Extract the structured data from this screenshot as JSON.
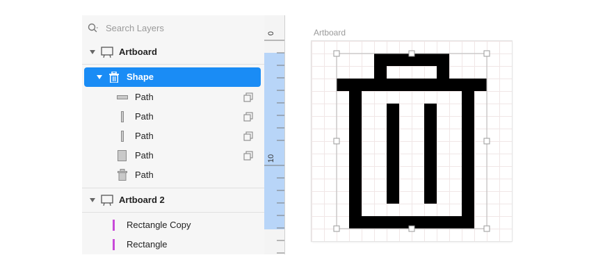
{
  "search": {
    "placeholder": "Search Layers"
  },
  "layers": {
    "artboard1": {
      "name": "Artboard",
      "children": [
        {
          "name": "Shape",
          "children": [
            {
              "name": "Path",
              "icon": "horizontal-bar-icon"
            },
            {
              "name": "Path",
              "icon": "vertical-bar-icon"
            },
            {
              "name": "Path",
              "icon": "vertical-bar-icon"
            },
            {
              "name": "Path",
              "icon": "rectangle-icon"
            },
            {
              "name": "Path",
              "icon": "trash-path-icon"
            }
          ]
        }
      ]
    },
    "artboard2": {
      "name": "Artboard 2",
      "children": [
        {
          "name": "Rectangle Copy",
          "icon": "magenta-line-icon"
        },
        {
          "name": "Rectangle",
          "icon": "magenta-line-icon"
        }
      ]
    }
  },
  "ruler": {
    "labels": [
      "0",
      "10"
    ]
  },
  "canvas": {
    "artboard_title": "Artboard"
  },
  "colors": {
    "selection": "#1a8cf5",
    "ruler_highlight": "#b8d5f8",
    "magenta": "#c84ad8",
    "shape_fill": "#000000"
  }
}
